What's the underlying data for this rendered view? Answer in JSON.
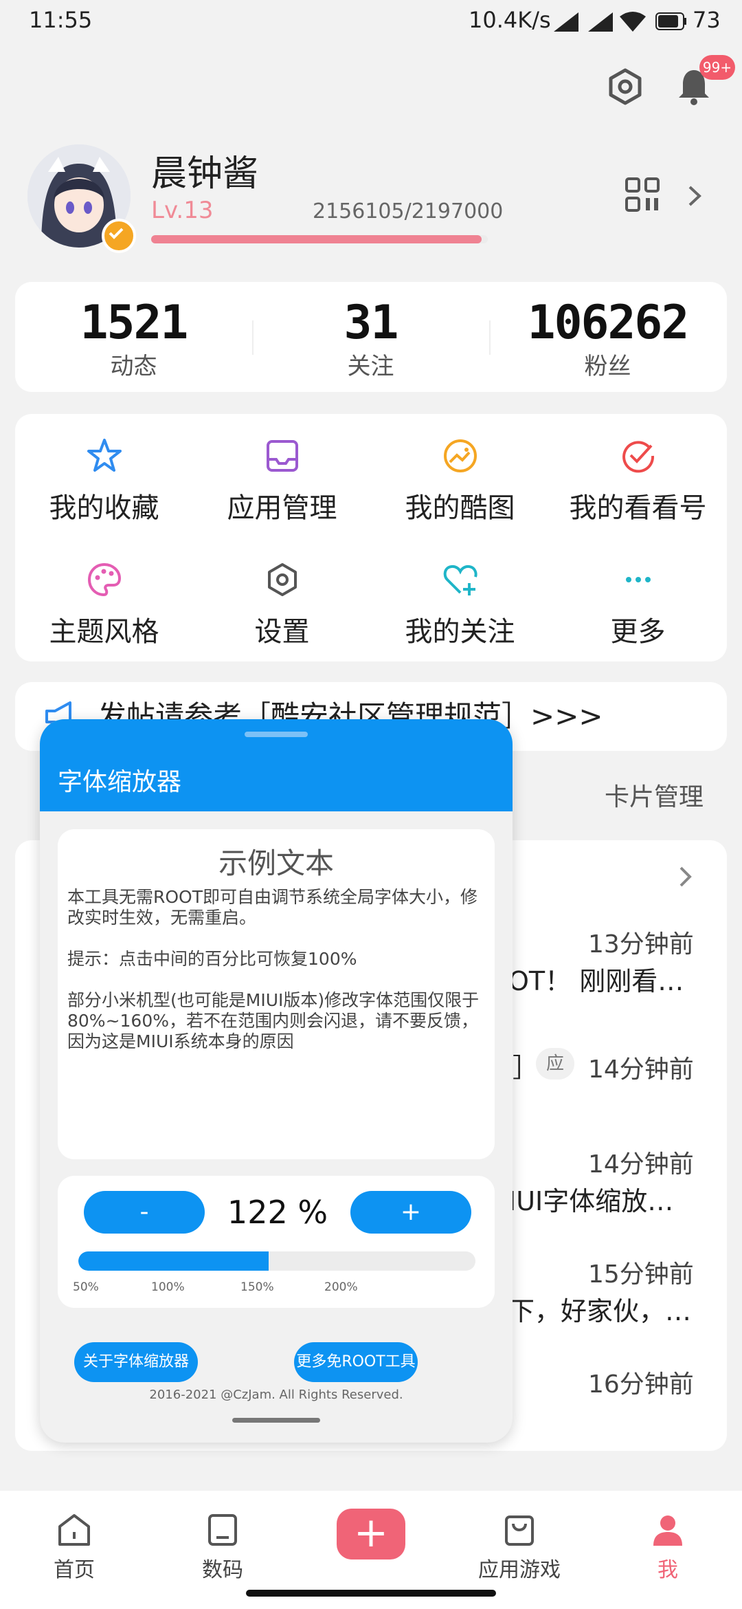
{
  "status_bar": {
    "time": "11:55",
    "network": "10.4K/s",
    "battery": "73"
  },
  "header": {
    "badge": "99+"
  },
  "profile": {
    "name": "晨钟酱",
    "level": "Lv.13",
    "exp": "2156105/2197000",
    "exp_progress": 0.9814
  },
  "stats": [
    {
      "value": "1521",
      "label": "动态"
    },
    {
      "value": "31",
      "label": "关注"
    },
    {
      "value": "106262",
      "label": "粉丝"
    }
  ],
  "menu": [
    {
      "label": "我的收藏",
      "icon": "star-icon",
      "color": "#2f8cf0"
    },
    {
      "label": "应用管理",
      "icon": "inbox-icon",
      "color": "#9b59d0"
    },
    {
      "label": "我的酷图",
      "icon": "image-icon",
      "color": "#f5a623"
    },
    {
      "label": "我的看看号",
      "icon": "check-circle-icon",
      "color": "#ee4b4b"
    },
    {
      "label": "主题风格",
      "icon": "palette-icon",
      "color": "#e45db3"
    },
    {
      "label": "设置",
      "icon": "gear-icon",
      "color": "#555555"
    },
    {
      "label": "我的关注",
      "icon": "heart-plus-icon",
      "color": "#1fb5c8"
    },
    {
      "label": "更多",
      "icon": "more-icon",
      "color": "#1fb5c8"
    }
  ],
  "notice": {
    "text": "发帖请参考［酷安社区管理规范］>>>"
  },
  "section": {
    "right_label": "卡片管理"
  },
  "feed": [
    {
      "time": "13分钟前",
      "text": "OT！ 刚刚看…"
    },
    {
      "time": "14分钟前",
      "text": "］",
      "tag": "应"
    },
    {
      "time": "14分钟前",
      "text": "IUI字体缩放…"
    },
    {
      "time": "15分钟前",
      "text": "下，好家伙，…"
    },
    {
      "time": "16分钟前",
      "text": ""
    }
  ],
  "dialog": {
    "title": "字体缩放器",
    "sample_title": "示例文本",
    "sample_body": "本工具无需ROOT即可自由调节系统全局字体大小，修改实时生效，无需重启。\n\n提示：点击中间的百分比可恢复100%\n\n部分小米机型(也可能是MIUI版本)修改字体范围仅限于80%~160%，若不在范围内则会闪退，请不要反馈，因为这是MIUI系统本身的原因",
    "minus_label": "-",
    "plus_label": "+",
    "percent": "122 %",
    "slider_value": 122,
    "slider_min": 50,
    "slider_max": 200,
    "ticks": [
      "50%",
      "100%",
      "150%",
      "200%"
    ],
    "about_button": "关于字体缩放器",
    "more_button": "更多免ROOT工具",
    "copyright": "2016-2021 @CzJam. All Rights Reserved."
  },
  "bottom_nav": [
    {
      "label": "首页"
    },
    {
      "label": "数码"
    },
    {
      "label": "+"
    },
    {
      "label": "应用游戏"
    },
    {
      "label": "我"
    }
  ],
  "colors": {
    "accent": "#0d93f2",
    "pink": "#f06477",
    "level": "#f08a96"
  }
}
